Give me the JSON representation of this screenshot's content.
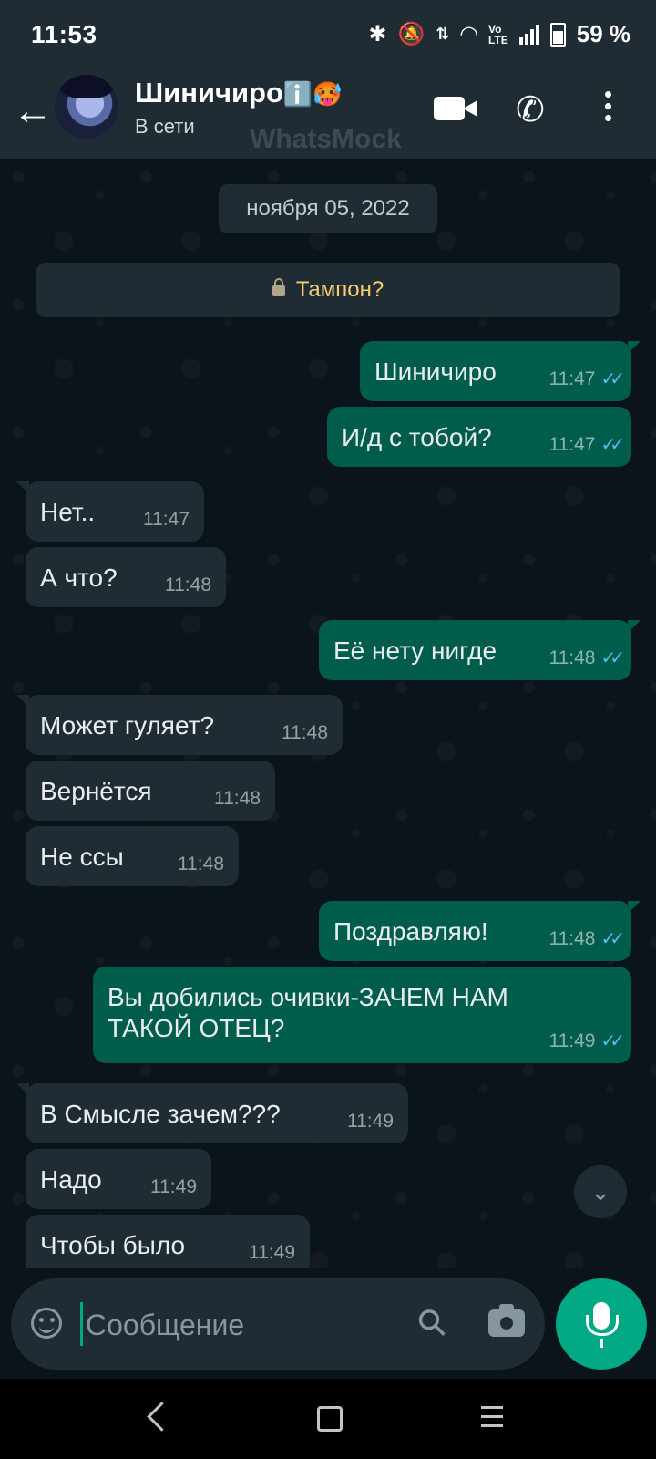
{
  "status_bar": {
    "time": "11:53",
    "battery_pct": "59 %",
    "icons": [
      "bluetooth-icon",
      "mute-icon",
      "data-arrows-icon",
      "wifi-icon",
      "volte-icon",
      "signal-icon",
      "battery-icon"
    ]
  },
  "header": {
    "contact_name": "Шиничиро",
    "name_emojis": "ℹ️🥵",
    "status": "В сети",
    "watermark": "WhatsMock"
  },
  "chat": {
    "date": "ноября 05, 2022",
    "encryption_text": "Тампон?",
    "messages": [
      {
        "dir": "out",
        "text": "Шиничиро",
        "time": "11:47",
        "ticks": "✓✓"
      },
      {
        "dir": "out",
        "text": "И/д с тобой?",
        "time": "11:47",
        "ticks": "✓✓"
      },
      {
        "dir": "in",
        "text": "Нет..",
        "time": "11:47"
      },
      {
        "dir": "in",
        "text": "А что?",
        "time": "11:48"
      },
      {
        "dir": "out",
        "text": "Её нету нигде",
        "time": "11:48",
        "ticks": "✓✓"
      },
      {
        "dir": "in",
        "text": "Может гуляет?",
        "time": "11:48"
      },
      {
        "dir": "in",
        "text": "Вернётся",
        "time": "11:48"
      },
      {
        "dir": "in",
        "text": "Не ссы",
        "time": "11:48"
      },
      {
        "dir": "out",
        "text": "Поздравляю!",
        "time": "11:48",
        "ticks": "✓✓"
      },
      {
        "dir": "out",
        "text_line1": "Вы добились очивки-ЗАЧЕМ НАМ",
        "text_line2": "ТАКОЙ ОТЕЦ?",
        "time": "11:49",
        "ticks": "✓✓"
      },
      {
        "dir": "in",
        "text": "В Смысле зачем???",
        "time": "11:49"
      },
      {
        "dir": "in",
        "text": "Надо",
        "time": "11:49"
      },
      {
        "dir": "in",
        "text": "Чтобы было",
        "time": "11:49"
      }
    ],
    "scroll_down_glyph": "⌄"
  },
  "composer": {
    "placeholder": "Сообщение"
  },
  "colors": {
    "bubble_out": "#005c4b",
    "bubble_in": "#202c33",
    "accent": "#00a884",
    "read_ticks": "#53bdeb"
  }
}
